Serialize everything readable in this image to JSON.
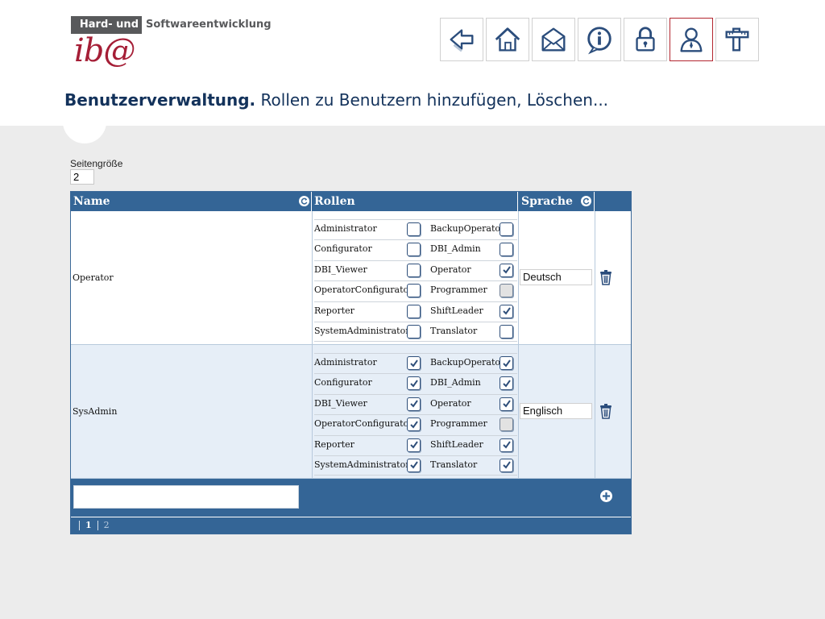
{
  "logo": {
    "box_text": "Hard- und",
    "rest_text": "Softwareentwicklung",
    "brand": "ib@"
  },
  "toolbar": [
    {
      "name": "back-button",
      "icon": "back-arrow-icon"
    },
    {
      "name": "home-button",
      "icon": "home-icon"
    },
    {
      "name": "mail-button",
      "icon": "mail-icon"
    },
    {
      "name": "info-button",
      "icon": "info-icon"
    },
    {
      "name": "lock-button",
      "icon": "lock-icon"
    },
    {
      "name": "users-button",
      "icon": "user-icon",
      "active": true
    },
    {
      "name": "tools-button",
      "icon": "tools-icon"
    }
  ],
  "page": {
    "title_strong": "Benutzerverwaltung.",
    "title_rest": "Rollen zu Benutzern hinzufügen, Löschen..."
  },
  "page_size": {
    "label": "Seitengröße",
    "value": "2"
  },
  "grid": {
    "headers": {
      "name": "Name",
      "roles": "Rollen",
      "language": "Sprache"
    },
    "rows": [
      {
        "name": "Operator",
        "language": "Deutsch",
        "roles": [
          [
            "Administrator",
            false,
            "BackupOperator",
            false
          ],
          [
            "Configurator",
            false,
            "DBI_Admin",
            false
          ],
          [
            "DBI_Viewer",
            false,
            "Operator",
            true
          ],
          [
            "OperatorConfigurator",
            false,
            "Programmer",
            false
          ],
          [
            "Reporter",
            false,
            "ShiftLeader",
            true
          ],
          [
            "SystemAdministrator",
            false,
            "Translator",
            false
          ]
        ]
      },
      {
        "name": "SysAdmin",
        "language": "Englisch",
        "roles": [
          [
            "Administrator",
            true,
            "BackupOperator",
            true
          ],
          [
            "Configurator",
            true,
            "DBI_Admin",
            true
          ],
          [
            "DBI_Viewer",
            true,
            "Operator",
            true
          ],
          [
            "OperatorConfigurator",
            true,
            "Programmer",
            false
          ],
          [
            "Reporter",
            true,
            "ShiftLeader",
            true
          ],
          [
            "SystemAdministrator",
            true,
            "Translator",
            true
          ]
        ]
      }
    ],
    "pager": {
      "pages": [
        "1",
        "2"
      ],
      "current": "1"
    }
  },
  "colors": {
    "header_blue": "#346596",
    "title_navy": "#13325b",
    "brand_red": "#a51e36",
    "active_border": "#b3262f"
  }
}
